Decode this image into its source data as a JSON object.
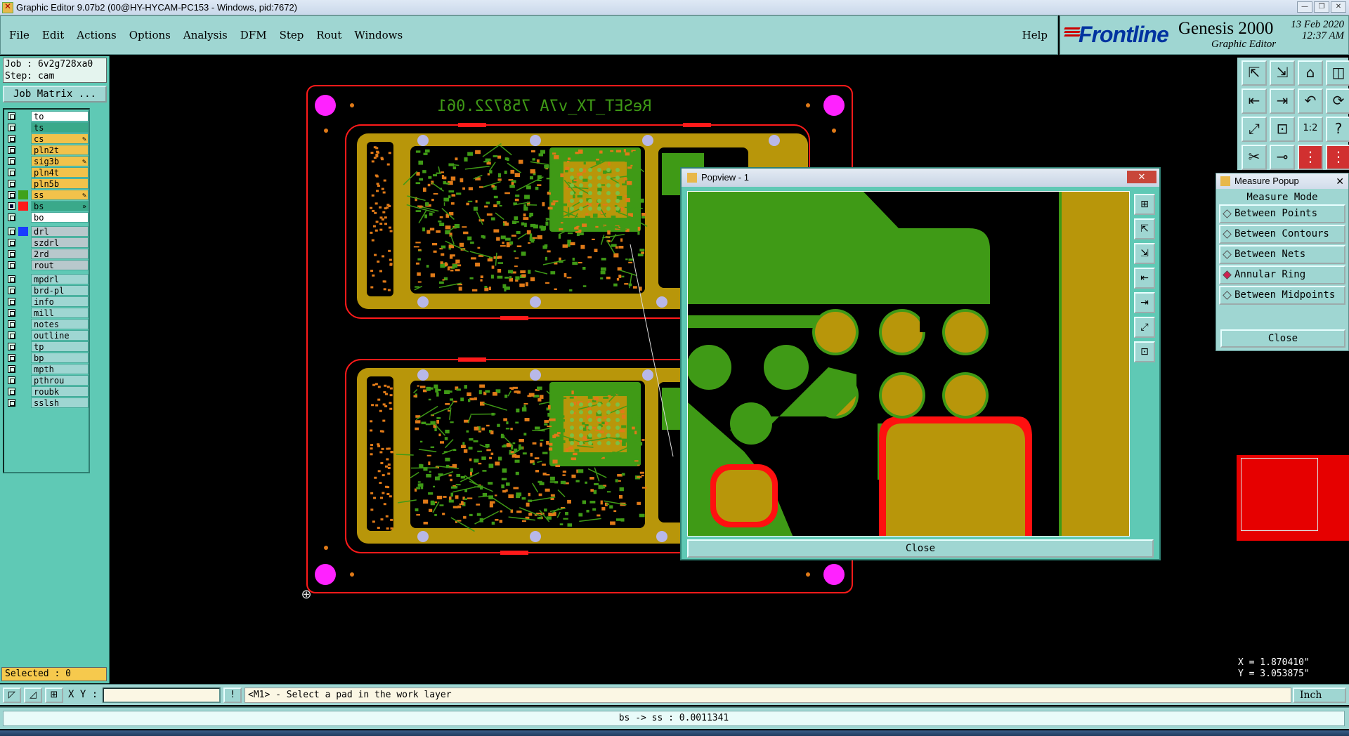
{
  "window": {
    "title": "Graphic Editor 9.07b2 (00@HY-HYCAM-PC153 - Windows, pid:7672)",
    "min_icon": "minimize-icon",
    "max_icon": "restore-icon",
    "close_icon": "close-icon"
  },
  "menu": [
    "File",
    "Edit",
    "Actions",
    "Options",
    "Analysis",
    "DFM",
    "Step",
    "Rout",
    "Windows"
  ],
  "help": "Help",
  "brand": {
    "logo": "Frontline",
    "product": "Genesis 2000",
    "subtitle": "Graphic Editor",
    "date": "13 Feb 2020",
    "time": "12:37 AM"
  },
  "job": {
    "job_line": "Job : 6v2g728xa0",
    "step_line": "Step: cam",
    "matrix_button": "Job Matrix ..."
  },
  "layers": [
    {
      "name": "to",
      "color": "#ffffff",
      "swatch": "",
      "mark": "",
      "state": "off"
    },
    {
      "name": "ts",
      "color": "#3aa98a",
      "swatch": "",
      "mark": "",
      "state": "off"
    },
    {
      "name": "cs",
      "color": "#f2c24b",
      "swatch": "",
      "mark": "✎",
      "state": "off"
    },
    {
      "name": "pln2t",
      "color": "#f2c24b",
      "swatch": "",
      "mark": "",
      "state": "off"
    },
    {
      "name": "sig3b",
      "color": "#f2c24b",
      "swatch": "",
      "mark": "✎",
      "state": "off"
    },
    {
      "name": "pln4t",
      "color": "#f2c24b",
      "swatch": "",
      "mark": "",
      "state": "off"
    },
    {
      "name": "pln5b",
      "color": "#f2c24b",
      "swatch": "",
      "mark": "",
      "state": "off"
    },
    {
      "name": "ss",
      "color": "#f2c24b",
      "swatch": "#3fa11a",
      "mark": "✎",
      "state": "off"
    },
    {
      "name": "bs",
      "color": "#3aa98a",
      "swatch": "#ff1a1a",
      "mark": "»",
      "state": "on"
    },
    {
      "name": "bo",
      "color": "#ffffff",
      "swatch": "",
      "mark": "",
      "state": "off"
    },
    {
      "name": "drl",
      "color": "#b8c8cc",
      "swatch": "#1a3cff",
      "mark": "",
      "state": "off"
    },
    {
      "name": "szdrl",
      "color": "#b8c8cc",
      "swatch": "",
      "mark": "",
      "state": "off"
    },
    {
      "name": "2rd",
      "color": "#b8c8cc",
      "swatch": "",
      "mark": "",
      "state": "off"
    },
    {
      "name": "rout",
      "color": "#b8c8cc",
      "swatch": "",
      "mark": "",
      "state": "off"
    },
    {
      "name": "mpdrl",
      "color": "#9fd6d2",
      "swatch": "",
      "mark": "",
      "state": "off"
    },
    {
      "name": "brd-pl",
      "color": "#9fd6d2",
      "swatch": "",
      "mark": "",
      "state": "off"
    },
    {
      "name": "info",
      "color": "#9fd6d2",
      "swatch": "",
      "mark": "",
      "state": "off"
    },
    {
      "name": "mill",
      "color": "#9fd6d2",
      "swatch": "",
      "mark": "",
      "state": "off"
    },
    {
      "name": "notes",
      "color": "#9fd6d2",
      "swatch": "",
      "mark": "",
      "state": "off"
    },
    {
      "name": "outline",
      "color": "#9fd6d2",
      "swatch": "",
      "mark": "",
      "state": "off"
    },
    {
      "name": "tp",
      "color": "#9fd6d2",
      "swatch": "",
      "mark": "",
      "state": "off"
    },
    {
      "name": "bp",
      "color": "#9fd6d2",
      "swatch": "",
      "mark": "",
      "state": "off"
    },
    {
      "name": "mpth",
      "color": "#9fd6d2",
      "swatch": "",
      "mark": "",
      "state": "off"
    },
    {
      "name": "pthrou",
      "color": "#9fd6d2",
      "swatch": "",
      "mark": "",
      "state": "off"
    },
    {
      "name": "roubk",
      "color": "#9fd6d2",
      "swatch": "",
      "mark": "",
      "state": "off"
    },
    {
      "name": "sslsh",
      "color": "#9fd6d2",
      "swatch": "",
      "mark": "",
      "state": "off"
    }
  ],
  "selected": "Selected : 0",
  "board": {
    "silkscreen_text": "ReSET_TX_v7A  758722.061",
    "colors": {
      "outline": "#ff1a1a",
      "copper": "#b8960a",
      "mask": "#3f9a16",
      "fiducial": "#ff22ff",
      "via": "#b8b8e8"
    }
  },
  "toolbar_icons": [
    "home-in-icon",
    "home-out-icon",
    "house-icon",
    "split-view-icon",
    "pan-left-icon",
    "pan-right-icon",
    "undo-view-icon",
    "redraw-icon",
    "fit-icon",
    "zoom-fit-icon",
    "scale-1to1-icon",
    "help-icon",
    "measure-icon",
    "snap-icon",
    "layers-a-icon",
    "layers-b-icon"
  ],
  "popview": {
    "title": "Popview - 1",
    "close_label": "Close",
    "tool_icons": [
      "zoom-box-icon",
      "zoom-in-icon",
      "zoom-out-icon",
      "pan-left-icon",
      "pan-right-icon",
      "fit-icon",
      "center-icon"
    ]
  },
  "measure": {
    "title": "Measure Popup",
    "heading": "Measure Mode",
    "options": [
      {
        "label": "Between Points",
        "selected": false
      },
      {
        "label": "Between Contours",
        "selected": false
      },
      {
        "label": "Between Nets",
        "selected": false
      },
      {
        "label": "Annular Ring",
        "selected": true
      },
      {
        "label": "Between Midpoints",
        "selected": false
      }
    ],
    "close_label": "Close"
  },
  "coords": {
    "x": "X = 1.870410\"",
    "y": "Y = 3.053875\""
  },
  "cmdline": {
    "xy_label": "X Y :",
    "xy_value": "",
    "prompt": "<M1> - Select a pad in the work layer",
    "units": "Inch"
  },
  "status": "bs -> ss : 0.0011341"
}
